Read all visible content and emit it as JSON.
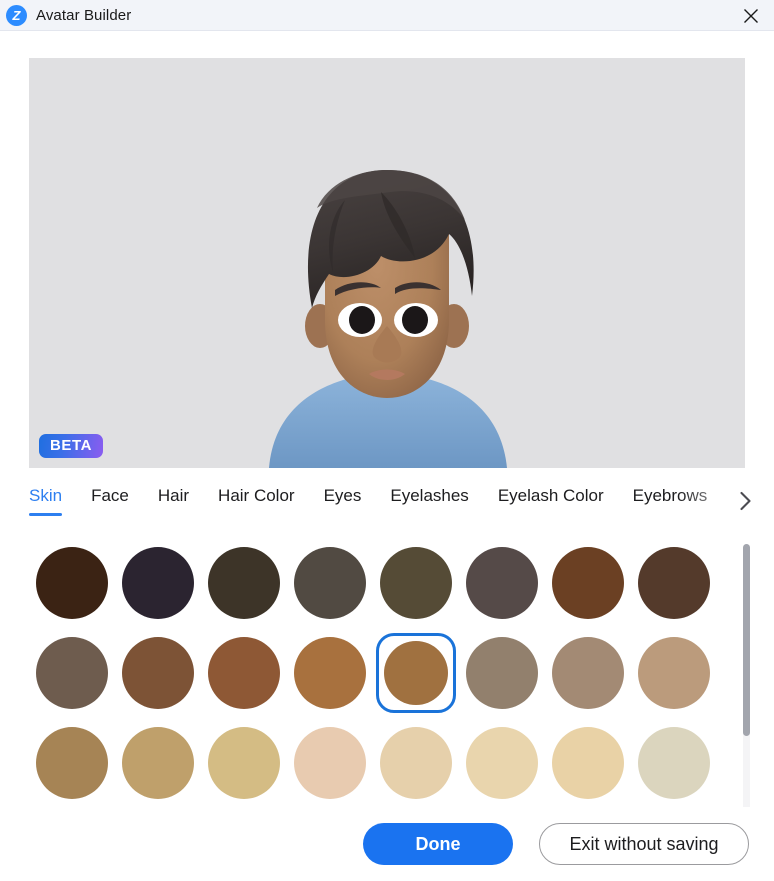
{
  "window": {
    "title": "Avatar Builder",
    "logo_text": "Z",
    "logo_icon": "zoom-logo-icon",
    "close_icon": "close-icon"
  },
  "preview": {
    "badge": "BETA",
    "background_color": "#e0e0e2",
    "avatar": {
      "skin_color": "#b0825e",
      "skin_shadow": "#8d6446",
      "hair_color": "#3b3534",
      "hair_shadow": "#2a2524",
      "eyebrow_color": "#3a3130",
      "eye_white": "#ffffff",
      "pupil_color": "#1b1718",
      "shirt_color": "#7fa9d4",
      "shirt_shadow": "#6d97c4",
      "lip_color": "#b4795f"
    }
  },
  "tabs": {
    "next_icon": "chevron-right-icon",
    "items": [
      {
        "label": "Skin",
        "active": true
      },
      {
        "label": "Face",
        "active": false
      },
      {
        "label": "Hair",
        "active": false
      },
      {
        "label": "Hair Color",
        "active": false
      },
      {
        "label": "Eyes",
        "active": false
      },
      {
        "label": "Eyelashes",
        "active": false
      },
      {
        "label": "Eyelash Color",
        "active": false
      },
      {
        "label": "Eyebrows",
        "active": false
      }
    ]
  },
  "swatches": {
    "selected_index": 12,
    "selection_color": "#1a73d9",
    "colors": [
      "#3b2314",
      "#2b2430",
      "#3d3428",
      "#514a42",
      "#554b36",
      "#554a48",
      "#6b4023",
      "#543a2b",
      "#6e5c4e",
      "#7d5336",
      "#8e5835",
      "#a8713e",
      "#a07140",
      "#92806d",
      "#a38a74",
      "#bb9b7c",
      "#a68455",
      "#bfa06b",
      "#d4bc84",
      "#e8cbb0",
      "#e6d0ab",
      "#e9d5ad",
      "#e9d2a6",
      "#dbd5be"
    ]
  },
  "scrollbar": {
    "thumb_color": "#a2a5ad",
    "track_color": "#f4f4f6"
  },
  "footer": {
    "done_label": "Done",
    "exit_label": "Exit without saving",
    "primary_color": "#1a73f0"
  }
}
